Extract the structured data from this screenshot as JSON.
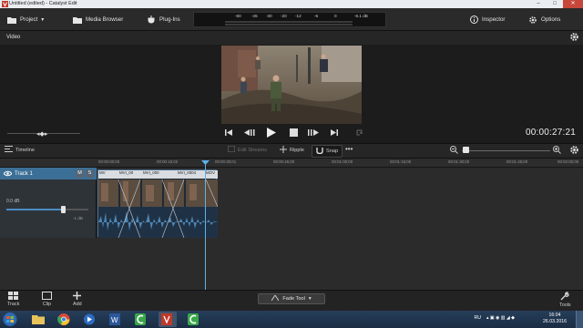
{
  "window": {
    "title": "Untitled (edited) - Catalyst Edit",
    "minimize": "–",
    "maximize": "□",
    "close": "✕"
  },
  "toolbar": {
    "project_label": "Project",
    "media_browser_label": "Media Browser",
    "plugins_label": "Plug-Ins",
    "inspector_label": "Inspector",
    "options_label": "Options",
    "meter_scale": [
      "-60",
      "-45",
      "-30",
      "-20",
      "-12",
      "-6",
      "0"
    ],
    "meter_peak": "-6.1 dB"
  },
  "video": {
    "section_label": "Video",
    "timecode": "00:00:27:21"
  },
  "timeline": {
    "label": "Timeline",
    "edit_streams_label": "Edit Streams",
    "ripple_label": "Ripple",
    "snap_label": "Snap",
    "ruler_ticks": [
      "00:00:00;00",
      "00:00:15;02",
      "00:00:30;01",
      "00:00:45;00",
      "00:01:00;00",
      "00:01:15;00",
      "00:01:30;00",
      "00:01:45;00",
      "00:02:00;00"
    ]
  },
  "track": {
    "name": "Track 1",
    "mute": "M",
    "solo": "S",
    "volume_db": "0.0 dB",
    "volume_level": 0.8,
    "pan_value": "-1 dB",
    "clips": [
      "MV",
      "MVI_00",
      "MVI_000",
      "MVI_0004",
      "MOV"
    ]
  },
  "bottom": {
    "track_label": "Track",
    "clip_label": "Clip",
    "add_label": "Add",
    "fade_tool_label": "Fade Tool",
    "tools_label": "Tools"
  },
  "taskbar": {
    "language": "RU",
    "time": "16:04",
    "date": "26.03.2016"
  },
  "colors": {
    "accent": "#5fb2e8",
    "track_header": "#3c6f96",
    "clip_border": "#4a6c8c"
  }
}
